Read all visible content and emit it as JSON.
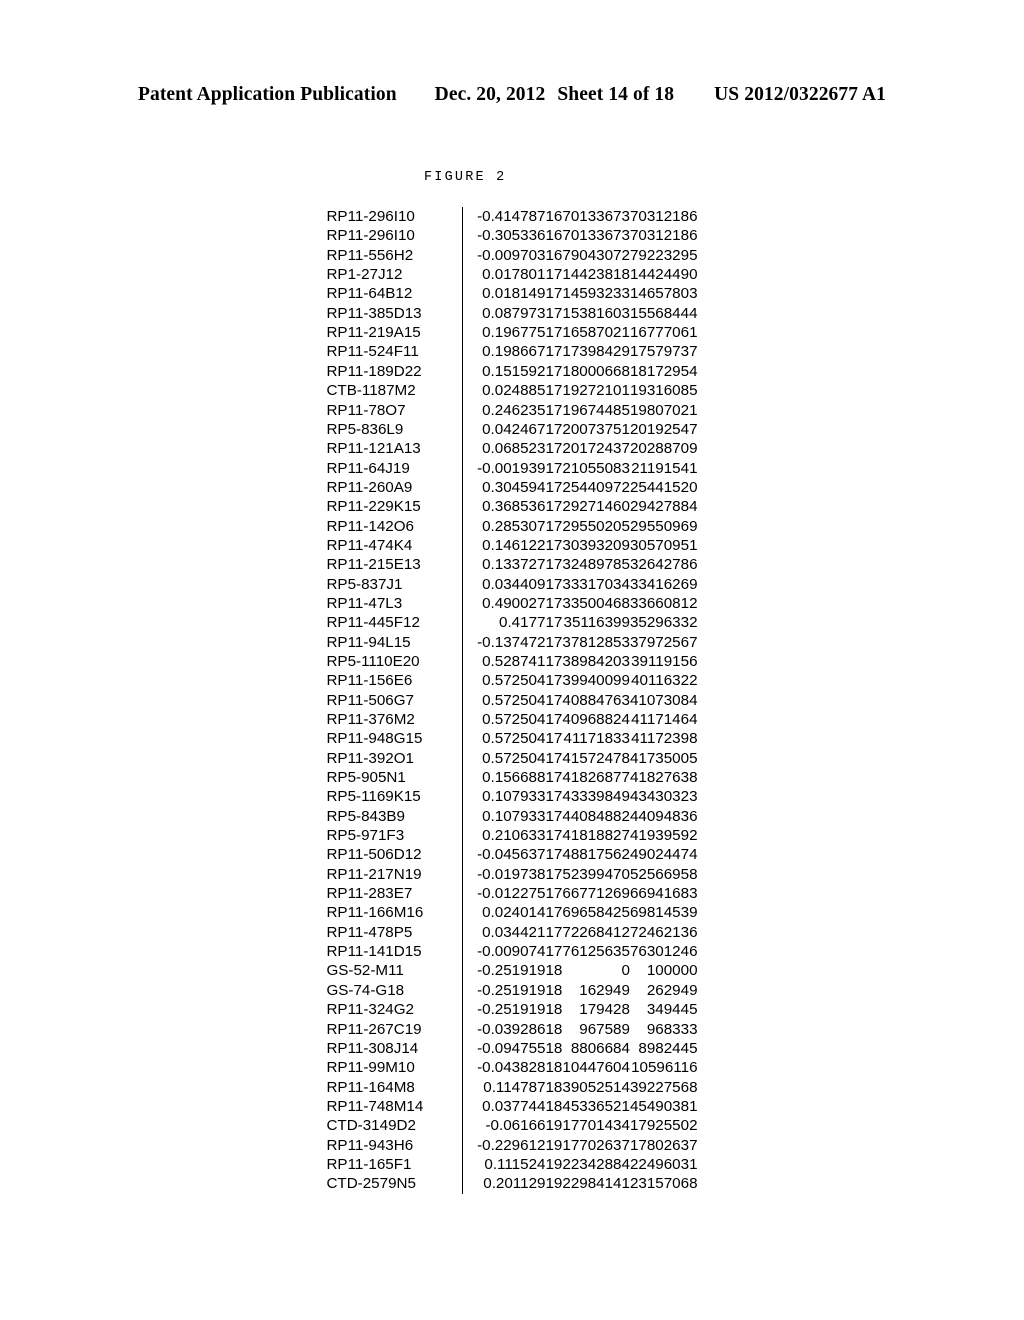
{
  "header": {
    "publication": "Patent Application Publication",
    "date": "Dec. 20, 2012",
    "sheet": "Sheet 14 of 18",
    "document_number": "US 2012/0322677 A1"
  },
  "figure": {
    "caption": "FIGURE 2"
  },
  "table": {
    "rows": [
      {
        "clone": "RP11-296I10",
        "value": "-0.414787",
        "chrom": "16",
        "start": "70133673",
        "end": "70312186"
      },
      {
        "clone": "RP11-296I10",
        "value": "-0.305336",
        "chrom": "16",
        "start": "70133673",
        "end": "70312186"
      },
      {
        "clone": "RP11-556H2",
        "value": "-0.009703",
        "chrom": "16",
        "start": "79043072",
        "end": "79223295"
      },
      {
        "clone": "RP1-27J12",
        "value": "0.017801",
        "chrom": "17",
        "start": "14423818",
        "end": "14424490"
      },
      {
        "clone": "RP11-64B12",
        "value": "0.018149",
        "chrom": "17",
        "start": "14593233",
        "end": "14657803"
      },
      {
        "clone": "RP11-385D13",
        "value": "0.087973",
        "chrom": "17",
        "start": "15381603",
        "end": "15568444"
      },
      {
        "clone": "RP11-219A15",
        "value": "0.196775",
        "chrom": "17",
        "start": "16587021",
        "end": "16777061"
      },
      {
        "clone": "RP11-524F11",
        "value": "0.198667",
        "chrom": "17",
        "start": "17398429",
        "end": "17579737"
      },
      {
        "clone": "RP11-189D22",
        "value": "0.151592",
        "chrom": "17",
        "start": "18000668",
        "end": "18172954"
      },
      {
        "clone": "CTB-1187M2",
        "value": "0.024885",
        "chrom": "17",
        "start": "19272101",
        "end": "19316085"
      },
      {
        "clone": "RP11-78O7",
        "value": "0.246235",
        "chrom": "17",
        "start": "19674485",
        "end": "19807021"
      },
      {
        "clone": "RP5-836L9",
        "value": "0.042467",
        "chrom": "17",
        "start": "20073751",
        "end": "20192547"
      },
      {
        "clone": "RP11-121A13",
        "value": "0.068523",
        "chrom": "17",
        "start": "20172437",
        "end": "20288709"
      },
      {
        "clone": "RP11-64J19",
        "value": "-0.001939",
        "chrom": "17",
        "start": "21055083",
        "end": "21191541"
      },
      {
        "clone": "RP11-260A9",
        "value": "0.304594",
        "chrom": "17",
        "start": "25440972",
        "end": "25441520"
      },
      {
        "clone": "RP11-229K15",
        "value": "0.368536",
        "chrom": "17",
        "start": "29271460",
        "end": "29427884"
      },
      {
        "clone": "RP11-142O6",
        "value": "0.285307",
        "chrom": "17",
        "start": "29550205",
        "end": "29550969"
      },
      {
        "clone": "RP11-474K4",
        "value": "0.146122",
        "chrom": "17",
        "start": "30393209",
        "end": "30570951"
      },
      {
        "clone": "RP11-215E13",
        "value": "0.133727",
        "chrom": "17",
        "start": "32489785",
        "end": "32642786"
      },
      {
        "clone": "RP5-837J1",
        "value": "0.034409",
        "chrom": "17",
        "start": "33317034",
        "end": "33416269"
      },
      {
        "clone": "RP11-47L3",
        "value": "0.490027",
        "chrom": "17",
        "start": "33500468",
        "end": "33660812"
      },
      {
        "clone": "RP11-445F12",
        "value": "0.4177",
        "chrom": "17",
        "start": "35116399",
        "end": "35296332"
      },
      {
        "clone": "RP11-94L15",
        "value": "-0.137472",
        "chrom": "17",
        "start": "37812853",
        "end": "37972567"
      },
      {
        "clone": "RP5-1110E20",
        "value": "0.528741",
        "chrom": "17",
        "start": "38984203",
        "end": "39119156"
      },
      {
        "clone": "RP11-156E6",
        "value": "0.572504",
        "chrom": "17",
        "start": "39940099",
        "end": "40116322"
      },
      {
        "clone": "RP11-506G7",
        "value": "0.572504",
        "chrom": "17",
        "start": "40884763",
        "end": "41073084"
      },
      {
        "clone": "RP11-376M2",
        "value": "0.572504",
        "chrom": "17",
        "start": "40968824",
        "end": "41171464"
      },
      {
        "clone": "RP11-948G15",
        "value": "0.572504",
        "chrom": "17",
        "start": "41171833",
        "end": "41172398"
      },
      {
        "clone": "RP11-392O1",
        "value": "0.572504",
        "chrom": "17",
        "start": "41572478",
        "end": "41735005"
      },
      {
        "clone": "RP5-905N1",
        "value": "0.156688",
        "chrom": "17",
        "start": "41826877",
        "end": "41827638"
      },
      {
        "clone": "RP5-1169K15",
        "value": "0.107933",
        "chrom": "17",
        "start": "43339849",
        "end": "43430323"
      },
      {
        "clone": "RP5-843B9",
        "value": "0.107933",
        "chrom": "17",
        "start": "44084882",
        "end": "44094836"
      },
      {
        "clone": "RP5-971F3",
        "value": "0.210633",
        "chrom": "17",
        "start": "41818827",
        "end": "41939592"
      },
      {
        "clone": "RP11-506D12",
        "value": "-0.045637",
        "chrom": "17",
        "start": "48817562",
        "end": "49024474"
      },
      {
        "clone": "RP11-217N19",
        "value": "-0.019738",
        "chrom": "17",
        "start": "52399470",
        "end": "52566958"
      },
      {
        "clone": "RP11-283E7",
        "value": "-0.012275",
        "chrom": "17",
        "start": "66771269",
        "end": "66941683"
      },
      {
        "clone": "RP11-166M16",
        "value": "0.024014",
        "chrom": "17",
        "start": "69658425",
        "end": "69814539"
      },
      {
        "clone": "RP11-478P5",
        "value": "0.034421",
        "chrom": "17",
        "start": "72268412",
        "end": "72462136"
      },
      {
        "clone": "RP11-141D15",
        "value": "-0.009074",
        "chrom": "17",
        "start": "76125635",
        "end": "76301246"
      },
      {
        "clone": "GS-52-M11",
        "value": "-0.251919",
        "chrom": "18",
        "start": "0",
        "end": "100000"
      },
      {
        "clone": "GS-74-G18",
        "value": "-0.251919",
        "chrom": "18",
        "start": "162949",
        "end": "262949"
      },
      {
        "clone": "RP11-324G2",
        "value": "-0.251919",
        "chrom": "18",
        "start": "179428",
        "end": "349445"
      },
      {
        "clone": "RP11-267C19",
        "value": "-0.039286",
        "chrom": "18",
        "start": "967589",
        "end": "968333"
      },
      {
        "clone": "RP11-308J14",
        "value": "-0.094755",
        "chrom": "18",
        "start": "8806684",
        "end": "8982445"
      },
      {
        "clone": "RP11-99M10",
        "value": "-0.043828",
        "chrom": "18",
        "start": "10447604",
        "end": "10596116"
      },
      {
        "clone": "RP11-164M8",
        "value": "0.114787",
        "chrom": "18",
        "start": "39052514",
        "end": "39227568"
      },
      {
        "clone": "RP11-748M14",
        "value": "0.037744",
        "chrom": "18",
        "start": "45336521",
        "end": "45490381"
      },
      {
        "clone": "CTD-3149D2",
        "value": "-0.06166",
        "chrom": "19",
        "start": "17701434",
        "end": "17925502"
      },
      {
        "clone": "RP11-943H6",
        "value": "-0.229612",
        "chrom": "19",
        "start": "17702637",
        "end": "17802637"
      },
      {
        "clone": "RP11-165F1",
        "value": "0.111524",
        "chrom": "19",
        "start": "22342884",
        "end": "22496031"
      },
      {
        "clone": "CTD-2579N5",
        "value": "0.201129",
        "chrom": "19",
        "start": "22984141",
        "end": "23157068"
      }
    ]
  }
}
